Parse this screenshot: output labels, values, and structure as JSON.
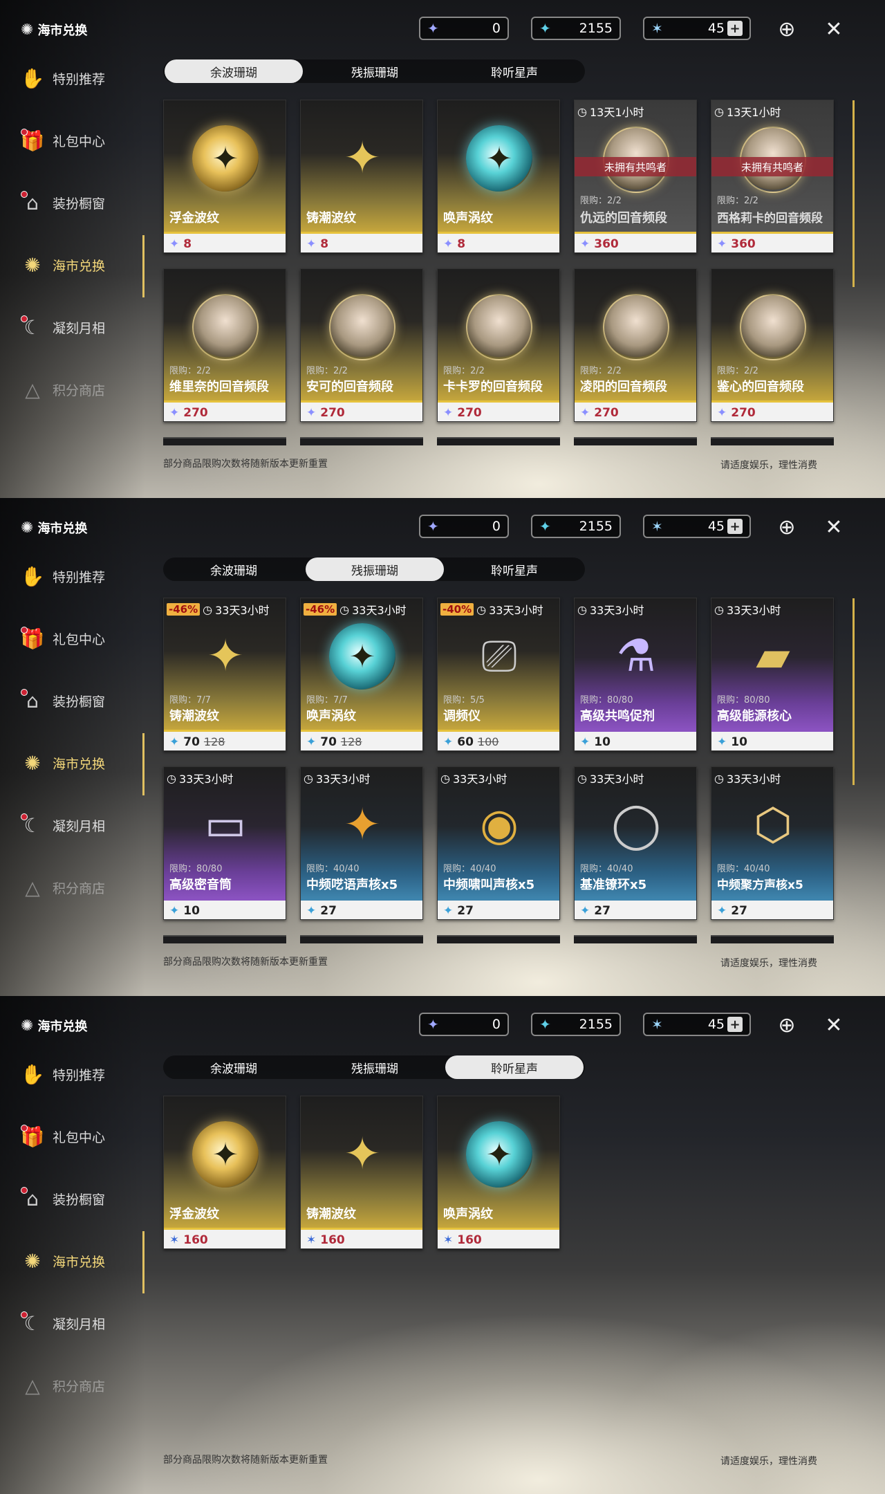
{
  "top": {
    "c1": "0",
    "c2": "2155",
    "c3": "45"
  },
  "sidebar": {
    "brand": "海市兑换",
    "items": [
      "特别推荐",
      "礼包中心",
      "装扮橱窗",
      "海市兑换",
      "凝刻月相",
      "积分商店"
    ]
  },
  "tabs": [
    "余波珊瑚",
    "残振珊瑚",
    "聆听星声"
  ],
  "footer": {
    "left": "部分商品限购次数将随新版本更新重置",
    "right": "请适度娱乐，理性消费"
  },
  "panel1": {
    "row1": [
      {
        "name": "浮金波纹",
        "price": "8"
      },
      {
        "name": "铸潮波纹",
        "price": "8"
      },
      {
        "name": "唤声涡纹",
        "price": "8"
      },
      {
        "name": "仇远的回音频段",
        "price": "360",
        "timer": "13天1小时",
        "banner": "未拥有共鸣者",
        "limit": "限购：2/2"
      },
      {
        "name": "西格莉卡的回音频段",
        "price": "360",
        "timer": "13天1小时",
        "banner": "未拥有共鸣者",
        "limit": "限购：2/2"
      }
    ],
    "row2": [
      {
        "name": "维里奈的回音频段",
        "price": "270",
        "limit": "限购：2/2"
      },
      {
        "name": "安可的回音频段",
        "price": "270",
        "limit": "限购：2/2"
      },
      {
        "name": "卡卡罗的回音频段",
        "price": "270",
        "limit": "限购：2/2"
      },
      {
        "name": "凌阳的回音频段",
        "price": "270",
        "limit": "限购：2/2"
      },
      {
        "name": "鉴心的回音频段",
        "price": "270",
        "limit": "限购：2/2"
      }
    ]
  },
  "panel2": {
    "row1": [
      {
        "name": "铸潮波纹",
        "price": "70",
        "old": "128",
        "disc": "-46%",
        "timer": "33天3小时",
        "limit": "限购：7/7"
      },
      {
        "name": "唤声涡纹",
        "price": "70",
        "old": "128",
        "disc": "-46%",
        "timer": "33天3小时",
        "limit": "限购：7/7"
      },
      {
        "name": "调频仪",
        "price": "60",
        "old": "100",
        "disc": "-40%",
        "timer": "33天3小时",
        "limit": "限购：5/5"
      },
      {
        "name": "高级共鸣促剂",
        "price": "10",
        "timer": "33天3小时",
        "limit": "限购：80/80"
      },
      {
        "name": "高级能源核心",
        "price": "10",
        "timer": "33天3小时",
        "limit": "限购：80/80"
      }
    ],
    "row2": [
      {
        "name": "高级密音筒",
        "price": "10",
        "timer": "33天3小时",
        "limit": "限购：80/80"
      },
      {
        "name": "中频呓语声核x5",
        "price": "27",
        "timer": "33天3小时",
        "limit": "限购：40/40"
      },
      {
        "name": "中频啸叫声核x5",
        "price": "27",
        "timer": "33天3小时",
        "limit": "限购：40/40"
      },
      {
        "name": "基准镣环x5",
        "price": "27",
        "timer": "33天3小时",
        "limit": "限购：40/40"
      },
      {
        "name": "中频聚方声核x5",
        "price": "27",
        "timer": "33天3小时",
        "limit": "限购：40/40"
      }
    ]
  },
  "panel3": {
    "row1": [
      {
        "name": "浮金波纹",
        "price": "160"
      },
      {
        "name": "铸潮波纹",
        "price": "160"
      },
      {
        "name": "唤声涡纹",
        "price": "160"
      }
    ]
  }
}
